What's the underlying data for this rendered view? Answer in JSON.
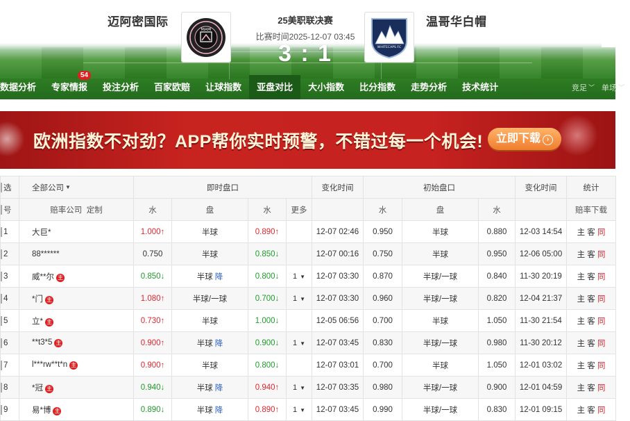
{
  "match": {
    "home_team": "迈阿密国际",
    "away_team": "温哥华白帽",
    "title": "25美职联决赛",
    "time": "比赛时间2025-12-07 03:45",
    "score": "3 : 1",
    "home_logo_text": "MIAMI",
    "away_logo_text": "WHITECAPS FC"
  },
  "nav": {
    "items": [
      "数据分析",
      "专家情报",
      "投注分析",
      "百家欧赔",
      "让球指数",
      "亚盘对比",
      "大小指数",
      "比分指数",
      "走势分析",
      "技术统计"
    ],
    "badge": "54",
    "active": "亚盘对比",
    "dropdowns": [
      "竞足",
      "单场"
    ]
  },
  "banner": {
    "text": "欧洲指数不对劲？APP帮你实时预警，不错过每一个机会!",
    "button": "立即下载"
  },
  "table": {
    "header1": {
      "select": "选",
      "company_filter": "全部公司",
      "live": "即时盘口",
      "change_time": "变化时间",
      "initial": "初始盘口",
      "change_time2": "变化时间",
      "stats": "统计"
    },
    "header2": {
      "no": "号",
      "company": "赔率公司",
      "custom": "定制",
      "water1": "水",
      "handicap": "盘",
      "water2": "水",
      "more": "更多",
      "i_water1": "水",
      "i_handicap": "盘",
      "i_water2": "水",
      "odds_download": "赔率下载"
    },
    "rows": [
      {
        "no": "1",
        "company": "大巨*",
        "zhu": false,
        "w1": "1.000↑",
        "w1c": "up",
        "pan": "半球",
        "jiang": "",
        "w2": "0.890↑",
        "w2c": "up",
        "more": "",
        "time": "12-07 02:46",
        "iw1": "0.950",
        "ipan": "半球",
        "iw2": "0.880",
        "itime": "12-03 14:54"
      },
      {
        "no": "2",
        "company": "88******",
        "zhu": false,
        "w1": "0.750",
        "w1c": "",
        "pan": "半球",
        "jiang": "",
        "w2": "0.850↓",
        "w2c": "dn",
        "more": "",
        "time": "12-07 00:16",
        "iw1": "0.750",
        "ipan": "半球",
        "iw2": "0.950",
        "itime": "12-06 05:00"
      },
      {
        "no": "3",
        "company": "威**尔",
        "zhu": true,
        "w1": "0.850↓",
        "w1c": "dn",
        "pan": "半球",
        "jiang": "降",
        "w2": "0.800↓",
        "w2c": "dn",
        "more": "1",
        "time": "12-07 03:30",
        "iw1": "0.870",
        "ipan": "半球/一球",
        "iw2": "0.840",
        "itime": "11-30 20:19"
      },
      {
        "no": "4",
        "company": "*门",
        "zhu": true,
        "w1": "1.080↑",
        "w1c": "up",
        "pan": "半球/一球",
        "jiang": "",
        "w2": "0.700↓",
        "w2c": "dn",
        "more": "1",
        "time": "12-07 03:30",
        "iw1": "0.960",
        "ipan": "半球/一球",
        "iw2": "0.820",
        "itime": "12-04 21:37"
      },
      {
        "no": "5",
        "company": "立*",
        "zhu": true,
        "w1": "0.730↑",
        "w1c": "up",
        "pan": "半球",
        "jiang": "",
        "w2": "1.000↓",
        "w2c": "dn",
        "more": "",
        "time": "12-05 06:56",
        "iw1": "0.700",
        "ipan": "半球",
        "iw2": "1.050",
        "itime": "11-30 21:54"
      },
      {
        "no": "6",
        "company": "**t3*5",
        "zhu": true,
        "w1": "0.900↑",
        "w1c": "up",
        "pan": "半球",
        "jiang": "降",
        "w2": "0.900↓",
        "w2c": "dn",
        "more": "1",
        "time": "12-07 03:45",
        "iw1": "0.830",
        "ipan": "半球/一球",
        "iw2": "0.980",
        "itime": "11-30 20:12"
      },
      {
        "no": "7",
        "company": "l***rw**t*n",
        "zhu": true,
        "w1": "0.900↑",
        "w1c": "up",
        "pan": "半球",
        "jiang": "",
        "w2": "0.800↓",
        "w2c": "dn",
        "more": "",
        "time": "12-07 03:01",
        "iw1": "0.700",
        "ipan": "半球",
        "iw2": "1.050",
        "itime": "12-01 03:02"
      },
      {
        "no": "8",
        "company": "*冠",
        "zhu": true,
        "w1": "0.940↓",
        "w1c": "dn",
        "pan": "半球",
        "jiang": "降",
        "w2": "0.940↑",
        "w2c": "up",
        "more": "1",
        "time": "12-07 03:35",
        "iw1": "0.980",
        "ipan": "半球/一球",
        "iw2": "0.900",
        "itime": "12-01 04:59"
      },
      {
        "no": "9",
        "company": "易*博",
        "zhu": true,
        "w1": "0.890↓",
        "w1c": "dn",
        "pan": "半球",
        "jiang": "降",
        "w2": "0.890↑",
        "w2c": "up",
        "more": "1",
        "time": "12-07 03:45",
        "iw1": "0.990",
        "ipan": "半球/一球",
        "iw2": "0.830",
        "itime": "12-01 09:15"
      }
    ],
    "actions": {
      "home": "主",
      "away": "客",
      "same": "同"
    },
    "zhu_label": "主"
  },
  "colors": {
    "up": "#e0262c",
    "down": "#1f9a2b",
    "nav_bg": "#2f7f24",
    "banner": "#c7231f"
  }
}
